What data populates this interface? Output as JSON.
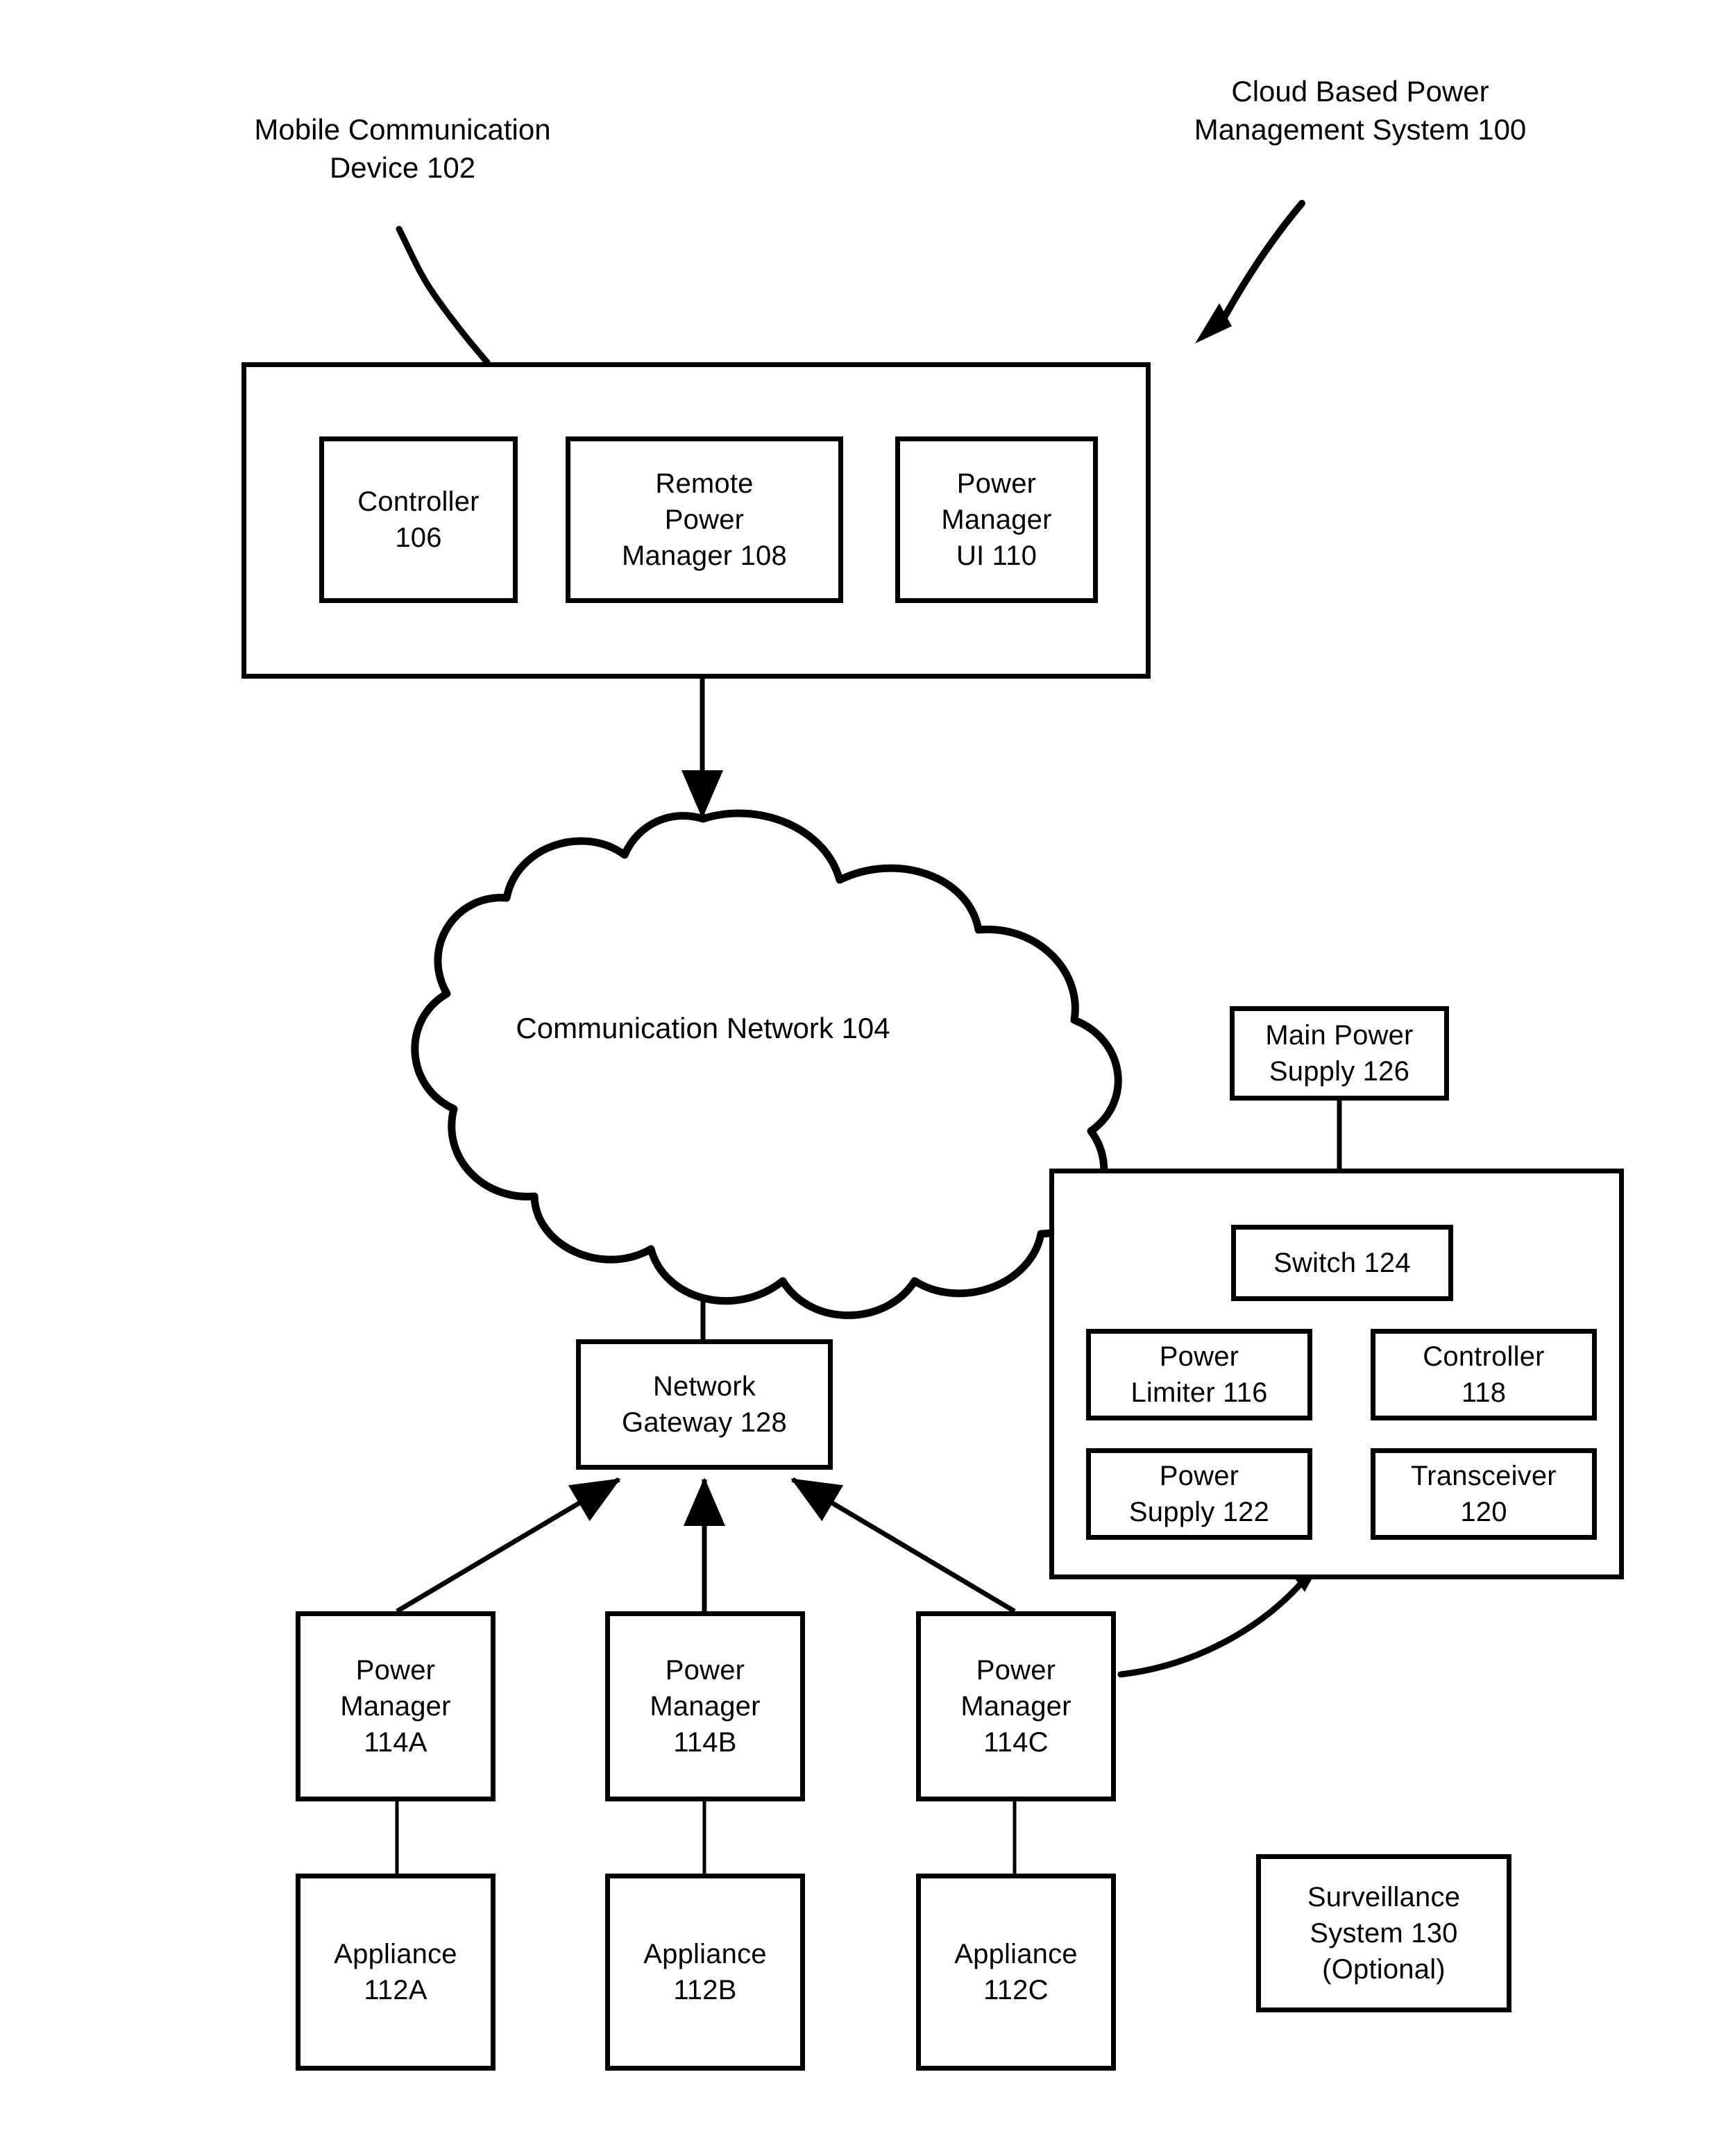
{
  "figure": {
    "title_label": "Cloud Based Power\nManagement System 100",
    "device_label": "Mobile Communication\nDevice 102",
    "stroke_color": "#000000",
    "background_color": "#ffffff"
  },
  "mobile_device": {
    "name": "Mobile Communication Device 102",
    "modules": [
      {
        "label": "Controller\n106"
      },
      {
        "label": "Remote\nPower\nManager 108"
      },
      {
        "label": "Power\nManager\nUI 110"
      }
    ]
  },
  "network": {
    "cloud_label": "Communication Network 104",
    "gateway_label": "Network\nGateway 128"
  },
  "power_managers": [
    {
      "label": "Power\nManager\n114A"
    },
    {
      "label": "Power\nManager\n114B"
    },
    {
      "label": "Power\nManager\n114C"
    }
  ],
  "appliances": [
    {
      "label": "Appliance\n112A"
    },
    {
      "label": "Appliance\n112B"
    },
    {
      "label": "Appliance\n112C"
    }
  ],
  "power_manager_detail": {
    "main_power_supply": "Main Power\nSupply 126",
    "switch": "Switch 124",
    "power_limiter": "Power\nLimiter 116",
    "controller": "Controller\n118",
    "power_supply": "Power\nSupply 122",
    "transceiver": "Transceiver\n120"
  },
  "surveillance": {
    "label": "Surveillance\nSystem 130\n(Optional)"
  }
}
